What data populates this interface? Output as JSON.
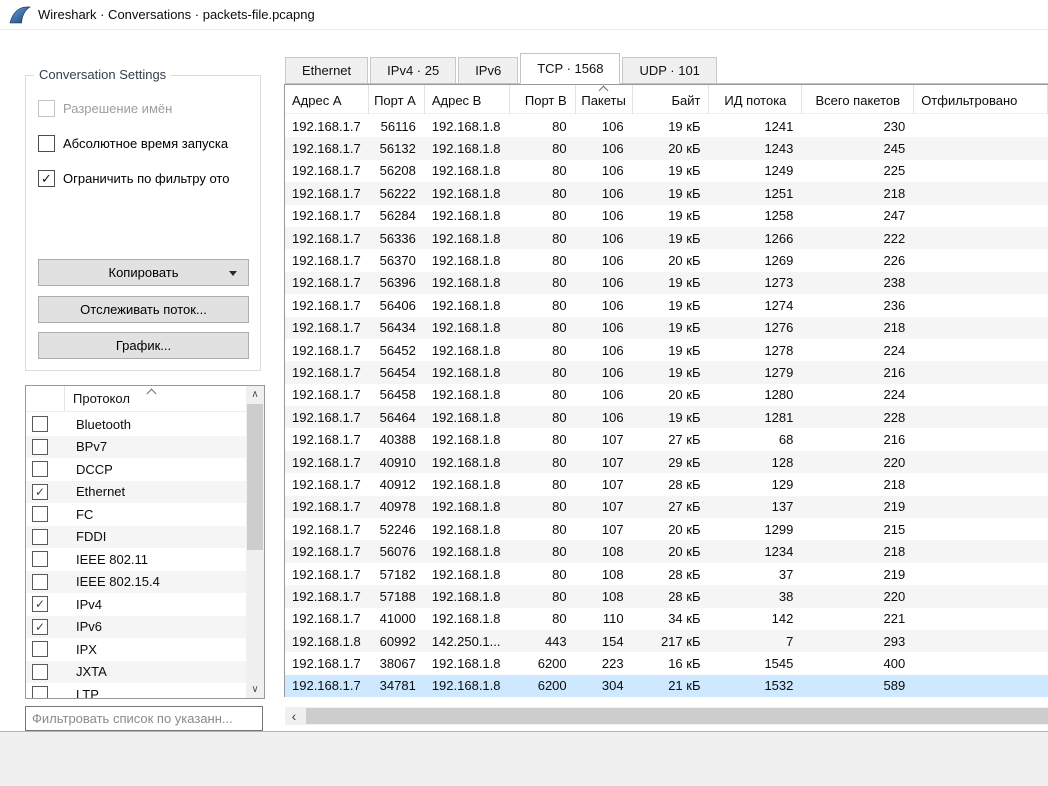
{
  "window": {
    "title": "Wireshark · Conversations · packets-file.pcapng",
    "icon": "wireshark-fin-icon"
  },
  "settings_panel": {
    "group_title": "Conversation Settings",
    "checkboxes": [
      {
        "label": "Разрешение имён",
        "checked": false,
        "enabled": false
      },
      {
        "label": "Абсолютное время запуска",
        "checked": false,
        "enabled": true
      },
      {
        "label": "Ограничить по фильтру ото",
        "checked": true,
        "enabled": true
      }
    ],
    "buttons": [
      {
        "label": "Копировать",
        "dropdown_icon": "chevron-down-icon"
      },
      {
        "label": "Отслеживать поток..."
      },
      {
        "label": "График..."
      }
    ]
  },
  "protocol_list": {
    "header": "Протокол",
    "sort_icon": "sort-ascending-icon",
    "items": [
      {
        "label": "Bluetooth",
        "checked": false
      },
      {
        "label": "BPv7",
        "checked": false
      },
      {
        "label": "DCCP",
        "checked": false
      },
      {
        "label": "Ethernet",
        "checked": true
      },
      {
        "label": "FC",
        "checked": false
      },
      {
        "label": "FDDI",
        "checked": false
      },
      {
        "label": "IEEE 802.11",
        "checked": false
      },
      {
        "label": "IEEE 802.15.4",
        "checked": false
      },
      {
        "label": "IPv4",
        "checked": true
      },
      {
        "label": "IPv6",
        "checked": true
      },
      {
        "label": "IPX",
        "checked": false
      },
      {
        "label": "JXTA",
        "checked": false
      },
      {
        "label": "LTP",
        "checked": false
      }
    ],
    "scrollbar": {
      "up_icon": "∧",
      "down_icon": "∨"
    }
  },
  "filter_input": {
    "placeholder": "Фильтровать список по указанн..."
  },
  "tabs": [
    {
      "label": "Ethernet",
      "active": false
    },
    {
      "label": "IPv4 · 25",
      "active": false
    },
    {
      "label": "IPv6",
      "active": false
    },
    {
      "label": "TCP · 1568",
      "active": true
    },
    {
      "label": "UDP · 101",
      "active": false
    }
  ],
  "table": {
    "columns": [
      "Адрес A",
      "Порт A",
      "Адрес B",
      "Порт B",
      "Пакеты",
      "Байт",
      "ИД потока",
      "Всего пакетов",
      "Отфильтровано"
    ],
    "sorted_column": "Пакеты",
    "sort_direction": "ascending",
    "selected_row_index": 25,
    "rows": [
      [
        "192.168.1.7",
        "56116",
        "192.168.1.8",
        "80",
        "106",
        "19 кБ",
        "1241",
        "230",
        ""
      ],
      [
        "192.168.1.7",
        "56132",
        "192.168.1.8",
        "80",
        "106",
        "20 кБ",
        "1243",
        "245",
        ""
      ],
      [
        "192.168.1.7",
        "56208",
        "192.168.1.8",
        "80",
        "106",
        "19 кБ",
        "1249",
        "225",
        ""
      ],
      [
        "192.168.1.7",
        "56222",
        "192.168.1.8",
        "80",
        "106",
        "19 кБ",
        "1251",
        "218",
        ""
      ],
      [
        "192.168.1.7",
        "56284",
        "192.168.1.8",
        "80",
        "106",
        "19 кБ",
        "1258",
        "247",
        ""
      ],
      [
        "192.168.1.7",
        "56336",
        "192.168.1.8",
        "80",
        "106",
        "19 кБ",
        "1266",
        "222",
        ""
      ],
      [
        "192.168.1.7",
        "56370",
        "192.168.1.8",
        "80",
        "106",
        "20 кБ",
        "1269",
        "226",
        ""
      ],
      [
        "192.168.1.7",
        "56396",
        "192.168.1.8",
        "80",
        "106",
        "19 кБ",
        "1273",
        "238",
        ""
      ],
      [
        "192.168.1.7",
        "56406",
        "192.168.1.8",
        "80",
        "106",
        "19 кБ",
        "1274",
        "236",
        ""
      ],
      [
        "192.168.1.7",
        "56434",
        "192.168.1.8",
        "80",
        "106",
        "19 кБ",
        "1276",
        "218",
        ""
      ],
      [
        "192.168.1.7",
        "56452",
        "192.168.1.8",
        "80",
        "106",
        "19 кБ",
        "1278",
        "224",
        ""
      ],
      [
        "192.168.1.7",
        "56454",
        "192.168.1.8",
        "80",
        "106",
        "19 кБ",
        "1279",
        "216",
        ""
      ],
      [
        "192.168.1.7",
        "56458",
        "192.168.1.8",
        "80",
        "106",
        "20 кБ",
        "1280",
        "224",
        ""
      ],
      [
        "192.168.1.7",
        "56464",
        "192.168.1.8",
        "80",
        "106",
        "19 кБ",
        "1281",
        "228",
        ""
      ],
      [
        "192.168.1.7",
        "40388",
        "192.168.1.8",
        "80",
        "107",
        "27 кБ",
        "68",
        "216",
        ""
      ],
      [
        "192.168.1.7",
        "40910",
        "192.168.1.8",
        "80",
        "107",
        "29 кБ",
        "128",
        "220",
        ""
      ],
      [
        "192.168.1.7",
        "40912",
        "192.168.1.8",
        "80",
        "107",
        "28 кБ",
        "129",
        "218",
        ""
      ],
      [
        "192.168.1.7",
        "40978",
        "192.168.1.8",
        "80",
        "107",
        "27 кБ",
        "137",
        "219",
        ""
      ],
      [
        "192.168.1.7",
        "52246",
        "192.168.1.8",
        "80",
        "107",
        "20 кБ",
        "1299",
        "215",
        ""
      ],
      [
        "192.168.1.7",
        "56076",
        "192.168.1.8",
        "80",
        "108",
        "20 кБ",
        "1234",
        "218",
        ""
      ],
      [
        "192.168.1.7",
        "57182",
        "192.168.1.8",
        "80",
        "108",
        "28 кБ",
        "37",
        "219",
        ""
      ],
      [
        "192.168.1.7",
        "57188",
        "192.168.1.8",
        "80",
        "108",
        "28 кБ",
        "38",
        "220",
        ""
      ],
      [
        "192.168.1.7",
        "41000",
        "192.168.1.8",
        "80",
        "110",
        "34 кБ",
        "142",
        "221",
        ""
      ],
      [
        "192.168.1.8",
        "60992",
        "142.250.1...",
        "443",
        "154",
        "217 кБ",
        "7",
        "293",
        ""
      ],
      [
        "192.168.1.7",
        "38067",
        "192.168.1.8",
        "6200",
        "223",
        "16 кБ",
        "1545",
        "400",
        ""
      ],
      [
        "192.168.1.7",
        "34781",
        "192.168.1.8",
        "6200",
        "304",
        "21 кБ",
        "1532",
        "589",
        ""
      ]
    ]
  },
  "colors": {
    "selection": "#cde8ff",
    "alt_row": "#f5f5f5",
    "button_bg": "#e1e1e1",
    "scroll_thumb": "#cdcdcd",
    "wireshark_blue_dark": "#1b4f8a",
    "wireshark_blue_light": "#6ea6dd"
  }
}
